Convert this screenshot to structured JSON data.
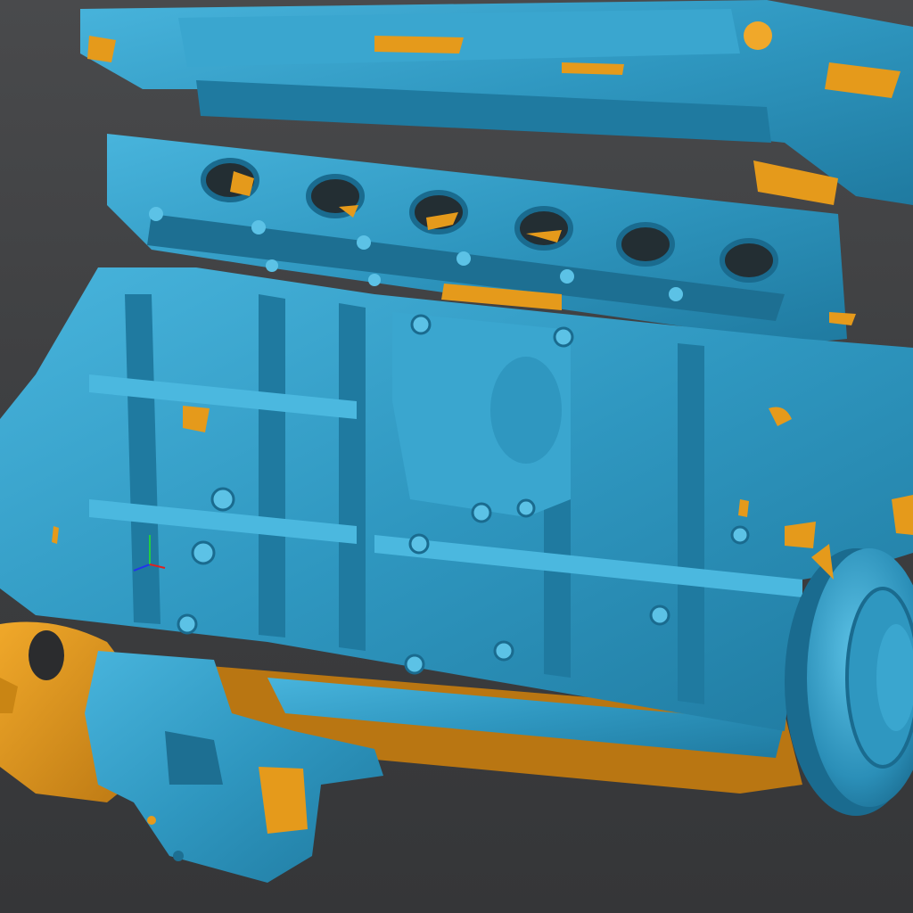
{
  "viewer": {
    "background_color": "#3f4042",
    "model_color": "#2f97c0",
    "model_shadow_color": "#1d6f92",
    "model_highlight_color": "#5cc2e6",
    "backface_color": "#e59a1b",
    "backface_shadow_color": "#a86c0c"
  },
  "model": {
    "subject": "engine-block-scan",
    "backface_visible": true
  },
  "axis_gizmo": {
    "visible": true,
    "x_color": "#2233ee",
    "y_color": "#22cc44",
    "z_color": "#dd2222"
  }
}
